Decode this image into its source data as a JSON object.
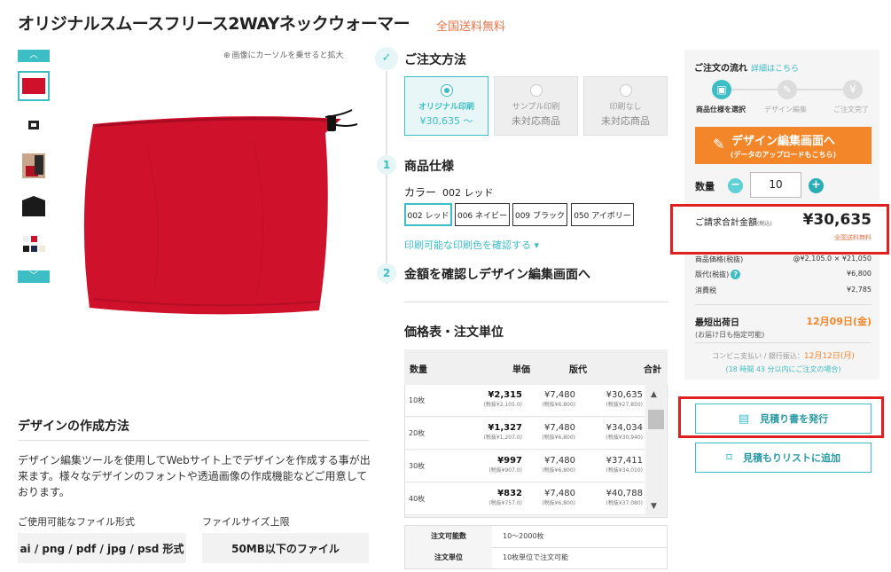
{
  "header": {
    "title": "オリジナルスムースフリース2WAYネックウォーマー",
    "free_shipping": "全国送料無料"
  },
  "gallery": {
    "zoom_hint": "画像にカーソルを乗せると拡大",
    "prev_icon": "chevron-up-icon",
    "next_icon": "chevron-down-icon",
    "thumb_count": 5
  },
  "design_method": {
    "title": "デザインの作成方法",
    "description": "デザイン編集ツールを使用してWebサイト上でデザインを作成する事が出来ます。様々なデザインのフォントや透過画像の作成機能などご用意しております。",
    "formats_label": "ご使用可能なファイル形式",
    "formats_value": "ai / png / pdf / jpg / psd 形式",
    "size_label": "ファイルサイズ上限",
    "size_value": "50MB以下のファイル"
  },
  "order_method": {
    "title": "ご注文方法",
    "options": [
      {
        "l1": "オリジナル印刷",
        "l2": "¥30,635 〜",
        "selected": true
      },
      {
        "l1": "サンプル印刷",
        "l2": "未対応商品",
        "selected": false
      },
      {
        "l1": "印刷なし",
        "l2": "未対応商品",
        "selected": false
      }
    ]
  },
  "spec": {
    "step": "1",
    "title": "商品仕様",
    "color_label": "カラー",
    "color_value": "002 レッド",
    "swatches": [
      "002 レッド",
      "006 ネイビー",
      "009 ブラック",
      "050 アイボリー"
    ],
    "print_colors_link": "印刷可能な印刷色を確認する ▾"
  },
  "confirm": {
    "step": "2",
    "title": "金額を確認しデザイン編集画面へ"
  },
  "price_table": {
    "title": "価格表・注文単位",
    "headers": {
      "qty": "数量",
      "unit": "単価",
      "plate": "版代",
      "total": "合計"
    },
    "rows": [
      {
        "qty": "10枚",
        "unit": "¥2,315",
        "unit_ex": "(税抜¥2,105.0)",
        "plate": "¥7,480",
        "plate_ex": "(税抜¥6,800)",
        "total": "¥30,635",
        "total_ex": "(税抜¥27,850)"
      },
      {
        "qty": "20枚",
        "unit": "¥1,327",
        "unit_ex": "(税抜¥1,207.0)",
        "plate": "¥7,480",
        "plate_ex": "(税抜¥6,800)",
        "total": "¥34,034",
        "total_ex": "(税抜¥30,940)"
      },
      {
        "qty": "30枚",
        "unit": "¥997",
        "unit_ex": "(税抜¥907.0)",
        "plate": "¥7,480",
        "plate_ex": "(税抜¥6,800)",
        "total": "¥37,411",
        "total_ex": "(税抜¥34,010)"
      },
      {
        "qty": "40枚",
        "unit": "¥832",
        "unit_ex": "(税抜¥757.0)",
        "plate": "¥7,480",
        "plate_ex": "(税抜¥6,800)",
        "total": "¥40,788",
        "total_ex": "(税抜¥37,080)"
      }
    ],
    "order_qty_label": "注文可能数",
    "order_qty_value": "10〜2000枚",
    "order_unit_label": "注文単位",
    "order_unit_value": "10枚単位で注文可能"
  },
  "flow": {
    "title": "ご注文の流れ",
    "detail_link": "詳細はこちら",
    "steps": [
      {
        "label": "商品仕様を選択",
        "icon": "gift-icon",
        "active": true
      },
      {
        "label": "デザイン編集",
        "icon": "pencil-icon",
        "active": false
      },
      {
        "label": "ご注文完了",
        "icon": "yen-icon",
        "active": false
      }
    ]
  },
  "design_button": {
    "l1": "デザイン編集画面へ",
    "l2": "(データのアップロードもこちら)"
  },
  "quantity": {
    "label": "数量",
    "value": "10"
  },
  "total": {
    "label": "ご請求合計金額",
    "label_sub": "(税込)",
    "value": "¥30,635",
    "shipping": "全国送料無料"
  },
  "breakdown": [
    {
      "k": "商品価格(税抜)",
      "v": "@¥2,105.0 × ¥21,050"
    },
    {
      "k": "版代(税抜)",
      "v": "¥6,800",
      "help": "?"
    },
    {
      "k": "消費税",
      "v": "¥2,785"
    }
  ],
  "shipping": {
    "label": "最短出荷日",
    "date": "12月09日(金)",
    "note": "(お届け日も指定可能)",
    "convenience": "コンビニ支払い / 銀行振込：",
    "convenience_date": "12月12日(月)",
    "remaining": "(18 時間 43 分以内にご注文の場合)"
  },
  "buttons": {
    "quote": "見積り書を発行",
    "quote_list": "見積もりリストに追加"
  },
  "colors": {
    "accent": "#3dbdc4",
    "orange": "#f4862a",
    "highlight": "#e02020",
    "product_red": "#d0112b"
  }
}
